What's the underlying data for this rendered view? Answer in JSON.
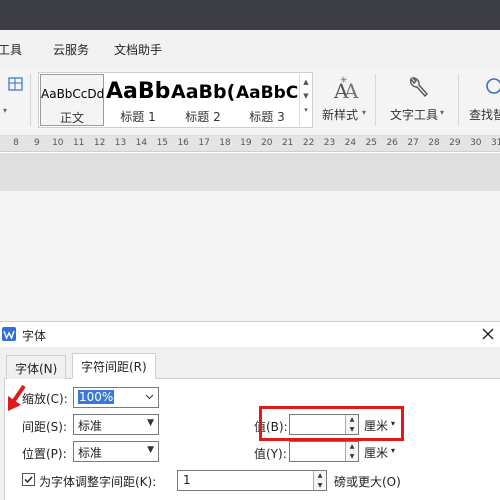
{
  "menubar": {
    "items": [
      {
        "label": "全工具"
      },
      {
        "label": "云服务"
      },
      {
        "label": "文档助手"
      }
    ]
  },
  "ribbon": {
    "styles": [
      {
        "sample": "AaBbCcDd",
        "label": "正文"
      },
      {
        "sample": "AaBb",
        "label": "标题 1"
      },
      {
        "sample": "AaBb(",
        "label": "标题 2"
      },
      {
        "sample": "AaBbC",
        "label": "标题 3"
      }
    ],
    "new_style_label": "新样式",
    "text_tool_label": "文字工具",
    "find_replace_label": "查找替"
  },
  "ruler": {
    "ticks": [
      "8",
      "9",
      "10",
      "11",
      "12",
      "13",
      "14",
      "15",
      "16",
      "17",
      "18",
      "19",
      "20",
      "21",
      "22",
      "23",
      "24",
      "25",
      "26",
      "27",
      "28",
      "29",
      "30",
      "31"
    ]
  },
  "dialog": {
    "title": "字体",
    "tabs": [
      {
        "label": "字体(N)",
        "active": false
      },
      {
        "label": "字符间距(R)",
        "active": true
      }
    ],
    "scale_label": "缩放(C):",
    "scale_value": "100%",
    "spacing_label": "间距(S):",
    "spacing_value": "标准",
    "spacing_value_label": "值(B):",
    "spacing_unit": "厘米",
    "position_label": "位置(P):",
    "position_value": "标准",
    "position_value_label": "值(Y):",
    "position_unit": "厘米",
    "kerning_label": "为字体调整字间距(K):",
    "kerning_checked": true,
    "kerning_value": "1",
    "kerning_suffix": "磅或更大(O)"
  },
  "colors": {
    "highlight_box": "#e0191c",
    "arrow": "#e0191c",
    "selection": "#3a78d8",
    "app_icon": "#2f6fd6"
  }
}
